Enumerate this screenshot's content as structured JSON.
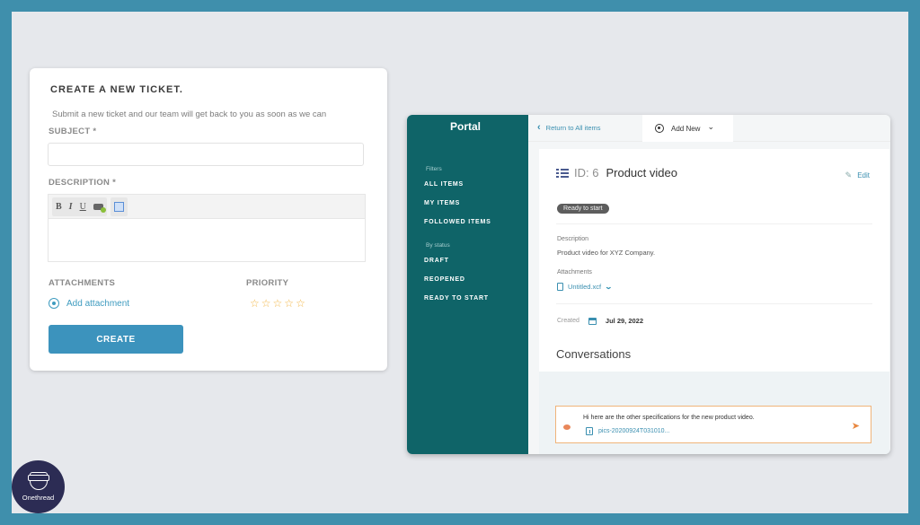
{
  "ticket_form": {
    "title": "CREATE A NEW TICKET.",
    "subtitle": "Submit a new ticket and our team will get back to you as soon as we can",
    "subject_label": "SUBJECT *",
    "subject_value": "",
    "description_label": "DESCRIPTION *",
    "description_value": "",
    "toolbar": {
      "bold": "B",
      "italic": "I",
      "underline": "U"
    },
    "attachments_label": "ATTACHMENTS",
    "add_attachment": "Add attachment",
    "priority_label": "PRIORITY",
    "priority_stars": [
      "☆",
      "☆",
      "☆",
      "☆",
      "☆"
    ],
    "priority_value": 0,
    "create_button": "CREATE",
    "accent_color": "#3c93bd"
  },
  "portal": {
    "sidebar": {
      "title": "Portal",
      "filters_label": "Filters",
      "filters": [
        "ALL ITEMS",
        "MY ITEMS",
        "FOLLOWED ITEMS"
      ],
      "status_label": "By status",
      "statuses": [
        "DRAFT",
        "REOPENED",
        "READY TO START"
      ]
    },
    "topbar": {
      "return_link": "Return to All items",
      "add_new": "Add New",
      "add_new_chevron": "⌄"
    },
    "item": {
      "id_label": "ID: 6",
      "title": "Product video",
      "edit": "Edit",
      "status": "Ready to start",
      "description_label": "Description",
      "description": "Product video for XYZ Company.",
      "attachments_label": "Attachments",
      "attachment_file": "Untitled.xcf",
      "created_label": "Created",
      "created_date": "Jul 29, 2022"
    },
    "conversations": {
      "title": "Conversations",
      "message": "Hi here are the other specifications for the new product video.",
      "message_file": "pics-20200924T031010..."
    },
    "sidebar_color": "#0f6468"
  },
  "logo": {
    "text": "Onethread"
  }
}
